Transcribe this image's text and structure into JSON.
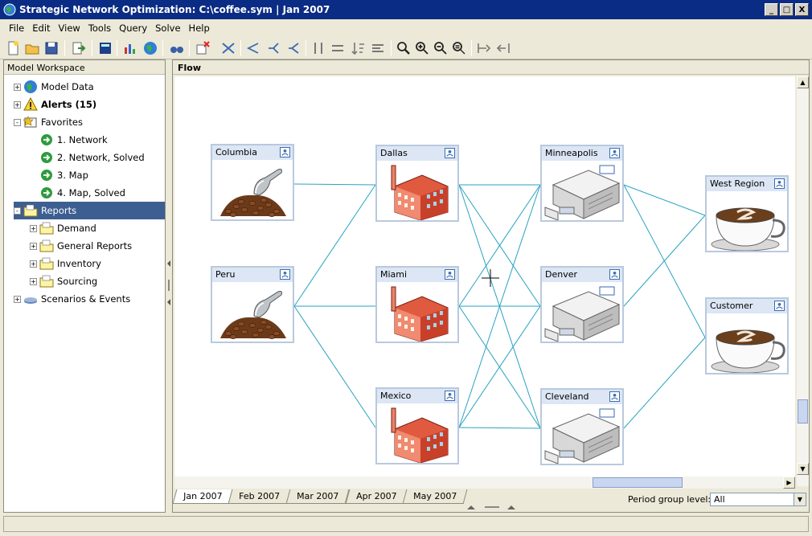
{
  "window": {
    "title": "Strategic Network Optimization:  C:\\coffee.sym | Jan 2007",
    "btn_min": "_",
    "btn_max": "□",
    "btn_close": "X"
  },
  "menu": [
    "File",
    "Edit",
    "View",
    "Tools",
    "Query",
    "Solve",
    "Help"
  ],
  "workspace": {
    "title": "Model Workspace",
    "items": [
      {
        "label": "Model Data",
        "icon": "globe-icon",
        "exp": "+"
      },
      {
        "label": "Alerts  (15)",
        "icon": "warning-icon",
        "exp": "+"
      },
      {
        "label": "Favorites",
        "icon": "favorites-icon",
        "exp": "-"
      },
      {
        "label": "1. Network",
        "icon": "favorite-link-icon",
        "exp": ""
      },
      {
        "label": "2. Network, Solved",
        "icon": "favorite-link-icon",
        "exp": ""
      },
      {
        "label": "3. Map",
        "icon": "favorite-link-icon",
        "exp": ""
      },
      {
        "label": "4. Map, Solved",
        "icon": "favorite-link-icon",
        "exp": ""
      },
      {
        "label": "Reports",
        "icon": "folder-icon",
        "exp": "-"
      },
      {
        "label": "Demand",
        "icon": "folder-icon",
        "exp": "+"
      },
      {
        "label": "General Reports",
        "icon": "folder-icon",
        "exp": "+"
      },
      {
        "label": "Inventory",
        "icon": "folder-icon",
        "exp": "+"
      },
      {
        "label": "Sourcing",
        "icon": "folder-icon",
        "exp": "+"
      },
      {
        "label": "Scenarios & Events",
        "icon": "scenarios-icon",
        "exp": "+"
      }
    ]
  },
  "flow": {
    "title": "Flow",
    "nodes": [
      {
        "label": "Columbia",
        "kind": "bean-pile-icon"
      },
      {
        "label": "Peru",
        "kind": "bean-pile-icon"
      },
      {
        "label": "Dallas",
        "kind": "factory-icon"
      },
      {
        "label": "Miami",
        "kind": "factory-icon"
      },
      {
        "label": "Mexico",
        "kind": "factory-icon"
      },
      {
        "label": "Minneapolis",
        "kind": "warehouse-icon"
      },
      {
        "label": "Denver",
        "kind": "warehouse-icon"
      },
      {
        "label": "Cleveland",
        "kind": "warehouse-icon"
      },
      {
        "label": "West Region",
        "kind": "coffee-cup-icon"
      },
      {
        "label": "Customer",
        "kind": "coffee-cup-icon"
      }
    ]
  },
  "periods": [
    "Jan 2007",
    "Feb 2007",
    "Mar 2007",
    "Apr 2007",
    "May 2007"
  ],
  "period_group": {
    "label": "Period group level:",
    "value": "All"
  },
  "colors": {
    "selection": "#3d5e91",
    "link": "#2aa3c0",
    "node_header": "#dce6f4"
  }
}
